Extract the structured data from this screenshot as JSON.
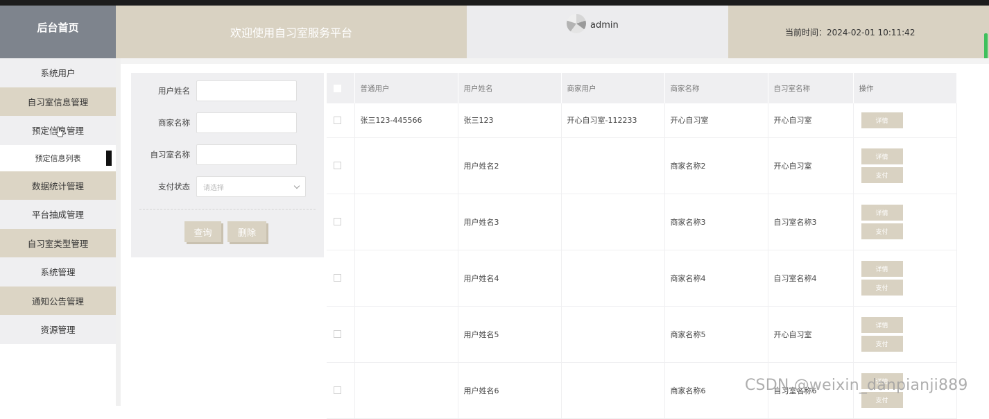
{
  "header": {
    "brand": "后台首页",
    "welcome": "欢迎使用自习室服务平台",
    "username": "admin",
    "clock": "当前时间：2024-02-01 10:11:42"
  },
  "sidebar": {
    "items": [
      {
        "label": "系统用户"
      },
      {
        "label": "自习室信息管理"
      },
      {
        "label": "预定信息管理"
      },
      {
        "label": "预定信息列表"
      },
      {
        "label": "数据统计管理"
      },
      {
        "label": "平台抽成管理"
      },
      {
        "label": "自习室类型管理"
      },
      {
        "label": "系统管理"
      },
      {
        "label": "通知公告管理"
      },
      {
        "label": "资源管理"
      }
    ]
  },
  "search": {
    "user_name_label": "用户姓名",
    "user_name_value": "",
    "merchant_name_label": "商家名称",
    "merchant_name_value": "",
    "room_name_label": "自习室名称",
    "room_name_value": "",
    "pay_status_label": "支付状态",
    "pay_status_placeholder": "请选择",
    "query_button": "查询",
    "delete_button": "删除"
  },
  "table": {
    "columns": [
      "普通用户",
      "用户姓名",
      "商家用户",
      "商家名称",
      "自习室名称",
      "操作"
    ],
    "rows": [
      {
        "normal_user": "张三123-445566",
        "user_name": "张三123",
        "merchant_user": "开心自习室-112233",
        "merchant_name": "开心自习室",
        "room_name": "开心自习室"
      },
      {
        "normal_user": "",
        "user_name": "用户姓名2",
        "merchant_user": "",
        "merchant_name": "商家名称2",
        "room_name": "开心自习室"
      },
      {
        "normal_user": "",
        "user_name": "用户姓名3",
        "merchant_user": "",
        "merchant_name": "商家名称3",
        "room_name": "自习室名称3"
      },
      {
        "normal_user": "",
        "user_name": "用户姓名4",
        "merchant_user": "",
        "merchant_name": "商家名称4",
        "room_name": "自习室名称4"
      },
      {
        "normal_user": "",
        "user_name": "用户姓名5",
        "merchant_user": "",
        "merchant_name": "商家名称5",
        "room_name": "开心自习室"
      },
      {
        "normal_user": "",
        "user_name": "用户姓名6",
        "merchant_user": "",
        "merchant_name": "商家名称6",
        "room_name": "自习室名称6"
      }
    ],
    "detail_label": "详情",
    "pay_label": "支付"
  },
  "watermark": "CSDN @weixin_danpianji889",
  "colors": {
    "tan": "#d9d2c2",
    "brand_bg": "#7e848d",
    "light_gray": "#efeff1"
  }
}
